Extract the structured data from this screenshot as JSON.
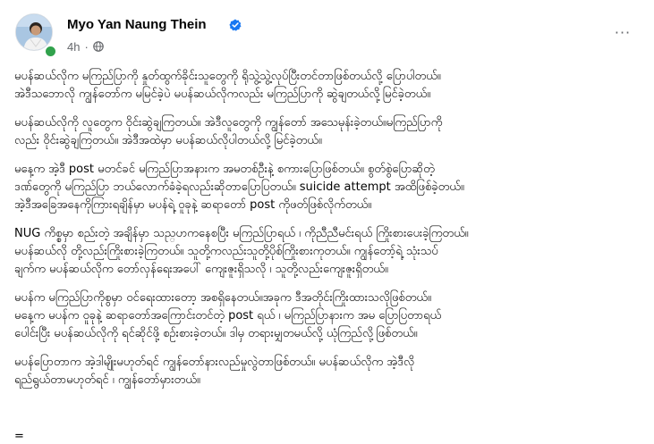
{
  "post": {
    "author_name": "Myo Yan Naung Thein",
    "timestamp": "4h",
    "separator": "·",
    "audience_icon": "globe-icon",
    "verified_icon": "verified-badge-icon",
    "more_icon": "more-options-icon",
    "more_label": "···",
    "colors": {
      "verified": "#1877f2",
      "online": "#31a24c",
      "secondary_text": "#65676b"
    }
  },
  "paragraphs": [
    {
      "lines": [
        "မပန်ဆယ်လိုက မကြည်ပြာကို နှုတ်ထွက်ခိုင်းသူတွေကို ရိုသွဲ့သွဲ့လုပ်ပြီးတင်တာဖြစ်တယ်လို့ ပြောပါတယ်။",
        "အဲဒီသဘောလို ကျွန်တော်က မမြင်ခဲ့ပဲ မပန်ဆယ်လိုကလည်း မကြည်ပြာကို ဆွဲချတယ်လို့မြင်ခဲ့တယ်။"
      ]
    },
    {
      "lines": [
        "မပန်ဆယ်လိုကို လူတွေက ဝိုင်းဆွဲချကြတယ်။ အဲဒီလူတွေကို ကျွန်တော် အသေမုန်းခဲ့တယ်။မကြည်ပြာကို",
        "လည်း ဝိုင်းဆွဲချကြတယ်။ အဲဒီအထဲမှာ မပန်ဆယ်လိုပါတယ်လို့ မြင်ခဲ့တယ်။"
      ]
    },
    {
      "lines": [
        "မနေ့က အဲ့ဒီ post မတင်ခင် မကြည်ပြာအနားက အမတစ်ဦးနဲ့ စကားပြောဖြစ်တယ်။ စွတ်စွဲပြောဆိုတဲ့",
        "ဒဏ်တွေကို မကြည်ပြာ ဘယ်လောက်ခံခဲ့ရလည်းဆိုတာပြောပြတယ်။ suicide attempt အထိဖြစ်ခဲ့တယ်။",
        "အဲ့ဒီအခြေအနေကိုကြားရချိန်မှာ မပန်ရဲ့ ဝူခုနဲ့ ဆရာတော် post ကိုဖတ်ဖြစ်လိုက်တယ်။"
      ]
    },
    {
      "lines": [
        "NUG ကိစ္စမှာ စည်းတဲ့ အချိန်မှာ သည္ဟကနေစပြီး မကြည်ပြာရယ် ၊ ကိုညီညီမင်းရယ် ကြိုးစားပေးခဲ့ကြတယ်။",
        "မပန်ဆယ်လို တို့လည်းကြိုးစားခဲ့ကြတယ်။ သူတို့ကလည်းသူတို့ပိုစ်ကြိုးစားကုတယ်။ ကျွန်တော့်ရဲ့ သုံးသပ်",
        "ချက်က မပန်ဆယ်လိုက တော်လှန်ရေးအပေါ် ကျေးဇူးရှိသလို ၊ သူတို့လည်းကျေးဇူးရှိတယ်။"
      ]
    },
    {
      "lines": [
        "မပန်က မကြည်ပြာကိုစွမှာ ဝင်ရေးထားတော့ အစရှိနေတယ်။အခုက ဒီအတိုင်းကြိုးထားသလိုဖြစ်တယ်။",
        "မနေ့က မပန်က ဝူခုနဲ့ ဆရာတော်အကြောင်းတင်တဲ့ post ရယ် ၊ မကြည်ပြာနားက အမ ပြောပြတာရယ်",
        "ပေါင်းပြီး  မပန်ဆယ်လိုကို ရင်ဆိုင်ဖို့ စဉ်းစားခဲ့တယ်။ ဒါမှ တရားမျှတမယ်လို့ ယုံကြည်လို့ဖြစ်တယ်။"
      ]
    },
    {
      "lines": [
        " မပန်ပြောတာက အဲ့ဒါမျိုးမဟုတ်ရင် ကျွန်တော်နားလည်မှုလွဲတာဖြစ်တယ်။ မပန်ဆယ်လိုက အဲ့ဒီလို",
        "ရည်ရွယ်တာမဟုတ်ရင် ၊ ကျွန်တော်မှားတယ်။"
      ]
    }
  ],
  "trailer": "="
}
